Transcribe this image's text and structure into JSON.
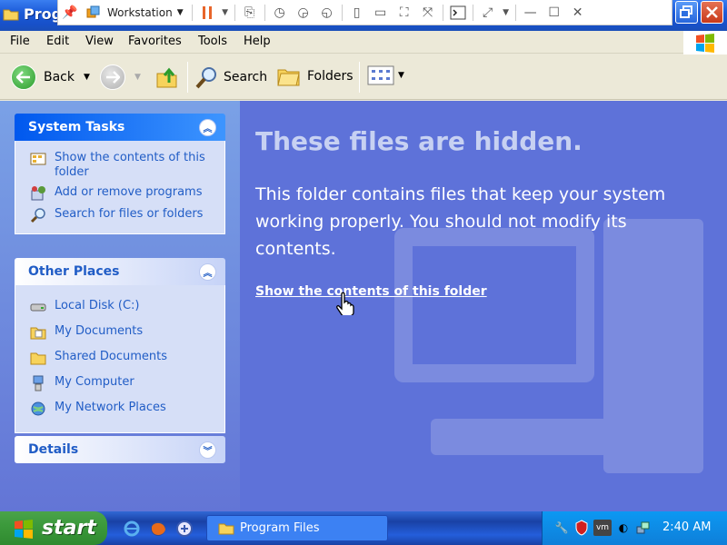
{
  "window": {
    "title": "Program Files",
    "title_visible": "Prog"
  },
  "vm_toolbar": {
    "workstation_label": "Workstation"
  },
  "menu": [
    "File",
    "Edit",
    "View",
    "Favorites",
    "Tools",
    "Help"
  ],
  "nav": {
    "back": "Back",
    "search": "Search",
    "folders": "Folders"
  },
  "task_pane": {
    "system_tasks": {
      "title": "System Tasks",
      "items": [
        {
          "label": "Show the contents of this folder",
          "icon": "folder-contents-icon"
        },
        {
          "label": "Add or remove programs",
          "icon": "add-remove-programs-icon"
        },
        {
          "label": "Search for files or folders",
          "icon": "search-icon"
        }
      ]
    },
    "other_places": {
      "title": "Other Places",
      "items": [
        {
          "label": "Local Disk (C:)",
          "icon": "local-disk-icon"
        },
        {
          "label": "My Documents",
          "icon": "my-documents-icon"
        },
        {
          "label": "Shared Documents",
          "icon": "shared-documents-icon"
        },
        {
          "label": "My Computer",
          "icon": "my-computer-icon"
        },
        {
          "label": "My Network Places",
          "icon": "network-places-icon"
        }
      ]
    },
    "details": {
      "title": "Details"
    }
  },
  "main": {
    "title": "These files are hidden.",
    "description": "This folder contains files that keep your system working properly. You should not modify its contents.",
    "link": "Show the contents of this folder"
  },
  "taskbar": {
    "start": "start",
    "task": "Program Files",
    "clock": "2:40 AM"
  },
  "colors": {
    "main_bg": "#5e72d9",
    "task_link": "#215dc6",
    "taskbar": "#245edb",
    "start_green": "#3c9a3c"
  }
}
